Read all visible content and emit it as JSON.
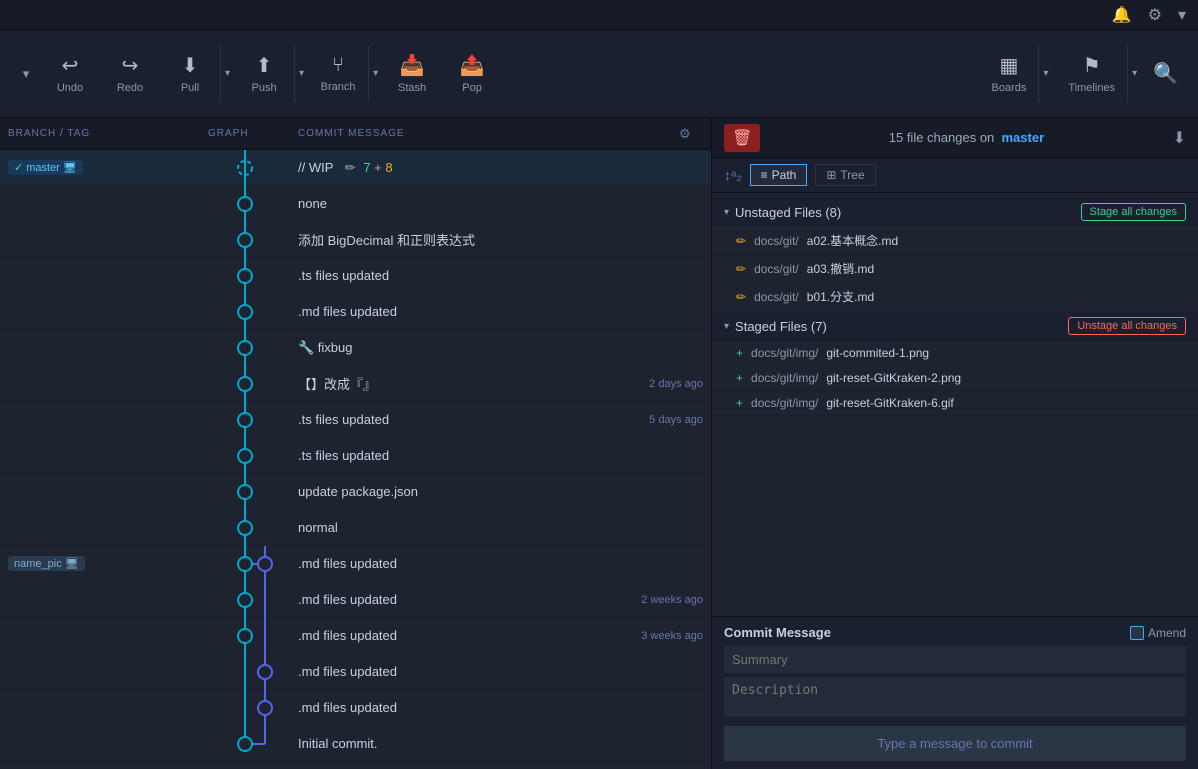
{
  "topbar": {
    "bell_icon": "🔔",
    "settings_icon": "⚙",
    "chevron_icon": "▾"
  },
  "toolbar": {
    "undo_label": "Undo",
    "redo_label": "Redo",
    "pull_label": "Pull",
    "push_label": "Push",
    "branch_label": "Branch",
    "stash_label": "Stash",
    "pop_label": "Pop",
    "boards_label": "Boards",
    "timelines_label": "Timelines",
    "dropdown_arrow": "▾"
  },
  "left_panel": {
    "col_branch": "BRANCH / TAG",
    "col_graph": "GRAPH",
    "col_commit": "COMMIT MESSAGE",
    "settings_icon": "⚙",
    "commits": [
      {
        "id": 0,
        "branch": "master",
        "msg": "// WIP",
        "wip_pencil": "✏",
        "wip_plus": "+",
        "modified": 7,
        "added": 8,
        "is_wip": true,
        "is_master": true
      },
      {
        "id": 1,
        "branch": "",
        "msg": "none",
        "time": ""
      },
      {
        "id": 2,
        "branch": "",
        "msg": "添加 BigDecimal 和正则表达式",
        "time": ""
      },
      {
        "id": 3,
        "branch": "",
        "msg": ".ts files updated",
        "time": ""
      },
      {
        "id": 4,
        "branch": "",
        "msg": ".md files updated",
        "time": ""
      },
      {
        "id": 5,
        "branch": "",
        "msg": "🔧 fixbug",
        "time": ""
      },
      {
        "id": 6,
        "branch": "",
        "msg": "【】改成『』",
        "time": "2 days ago"
      },
      {
        "id": 7,
        "branch": "",
        "msg": ".ts files updated",
        "time": "5 days ago"
      },
      {
        "id": 8,
        "branch": "",
        "msg": ".ts files updated",
        "time": ""
      },
      {
        "id": 9,
        "branch": "",
        "msg": "update package.json",
        "time": ""
      },
      {
        "id": 10,
        "branch": "",
        "msg": "normal",
        "time": ""
      },
      {
        "id": 11,
        "branch": "name_pic",
        "msg": ".md files updated",
        "time": ""
      },
      {
        "id": 12,
        "branch": "",
        "msg": ".md files updated",
        "time": "2 weeks ago"
      },
      {
        "id": 13,
        "branch": "",
        "msg": ".md files updated",
        "time": "3 weeks ago"
      },
      {
        "id": 14,
        "branch": "",
        "msg": ".md files updated",
        "time": ""
      },
      {
        "id": 15,
        "branch": "",
        "msg": ".md files updated",
        "time": ""
      },
      {
        "id": 16,
        "branch": "",
        "msg": "Initial commit.",
        "time": ""
      }
    ]
  },
  "right_panel": {
    "delete_icon": "🗑",
    "file_changes_text": "15 file changes on",
    "branch_name": "master",
    "download_icon": "⬇",
    "sort_icon": "↕ᵃ₂",
    "path_label": "≡ Path",
    "tree_label": "⊞ Tree",
    "unstaged_title": "Unstaged Files (8)",
    "stage_all_label": "Stage all changes",
    "unstaged_files": [
      {
        "path": "docs/git/",
        "name": "a02.基本概念.md",
        "icon": "✏"
      },
      {
        "path": "docs/git/",
        "name": "a03.撤销.md",
        "icon": "✏"
      },
      {
        "path": "docs/git/",
        "name": "b01.分支.md",
        "icon": "✏"
      }
    ],
    "staged_title": "Staged Files (7)",
    "unstage_all_label": "Unstage all changes",
    "staged_files": [
      {
        "path": "docs/git/img/",
        "name": "git-commited-1.png",
        "icon": "+"
      },
      {
        "path": "docs/git/img/",
        "name": "git-reset-GitKraken-2.png",
        "icon": "+"
      },
      {
        "path": "docs/git/img/",
        "name": "git-reset-GitKraken-6.gif",
        "icon": "+"
      }
    ],
    "commit_message_label": "Commit Message",
    "amend_label": "Amend",
    "summary_placeholder": "Summary",
    "description_placeholder": "Description",
    "commit_button_label": "Type a message to commit"
  }
}
